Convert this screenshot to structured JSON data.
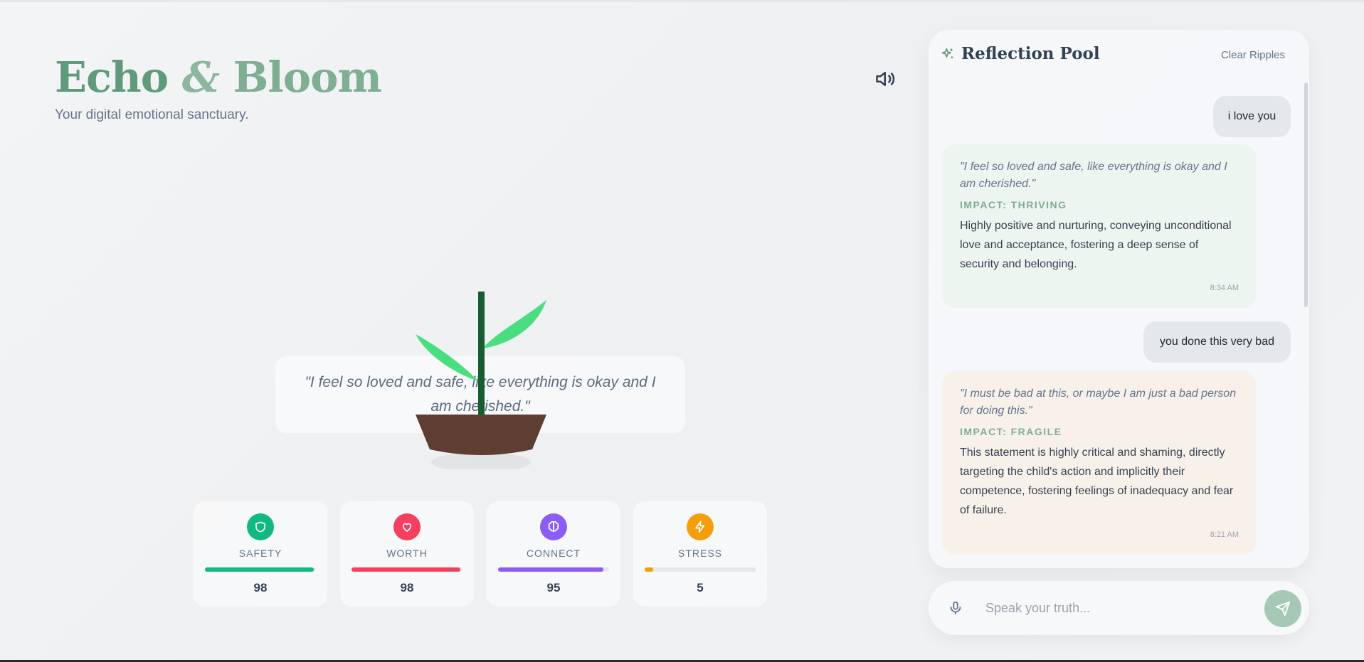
{
  "header": {
    "title_part1": "Echo",
    "title_amp": "&",
    "title_part2": "Bloom",
    "subtitle": "Your digital emotional sanctuary.",
    "sound_icon": "volume-icon"
  },
  "scene": {
    "quote": "\"I feel so loved and safe, like everything is okay and I am cherished.\""
  },
  "metrics": [
    {
      "label": "SAFETY",
      "value": "98",
      "level": 98,
      "color": "#10b981",
      "icon": "shield-icon"
    },
    {
      "label": "WORTH",
      "value": "98",
      "level": 98,
      "color": "#f43f5e",
      "icon": "heart-icon"
    },
    {
      "label": "CONNECT",
      "value": "95",
      "level": 95,
      "color": "#8b5cf6",
      "icon": "brain-icon"
    },
    {
      "label": "STRESS",
      "value": "5",
      "level": 5,
      "color": "#f59e0b",
      "icon": "lightning-icon"
    }
  ],
  "panel": {
    "title": "Reflection Pool",
    "title_icon": "sparkle-icon",
    "clear_label": "Clear Ripples",
    "messages": [
      {
        "role": "user",
        "text": "i love you"
      },
      {
        "role": "reflection",
        "quote": "\"I feel so loved and safe, like everything is okay and I am cherished.\"",
        "impact": "IMPACT: THRIVING",
        "description": "Highly positive and nurturing, conveying unconditional love and acceptance, fostering a deep sense of security and belonging.",
        "time": "8:34 AM"
      },
      {
        "role": "user",
        "text": "you done this very bad"
      },
      {
        "role": "reflection",
        "quote": "\"I must be bad at this, or maybe I am just a bad person for doing this.\"",
        "impact": "IMPACT: FRAGILE",
        "description": "This statement is highly critical and shaming, directly targeting the child's action and implicitly their competence, fostering feelings of inadequacy and fear of failure.",
        "time": "8:21 AM"
      }
    ]
  },
  "input": {
    "placeholder": "Speak your truth...",
    "value": "",
    "mic_icon": "microphone-icon",
    "send_icon": "send-icon"
  },
  "colors": {
    "brand": "#5f9b7a",
    "thriving_bg": "#edf5f1",
    "fragile_bg": "#f8f1ea",
    "send_button": "#a6c9b5"
  }
}
